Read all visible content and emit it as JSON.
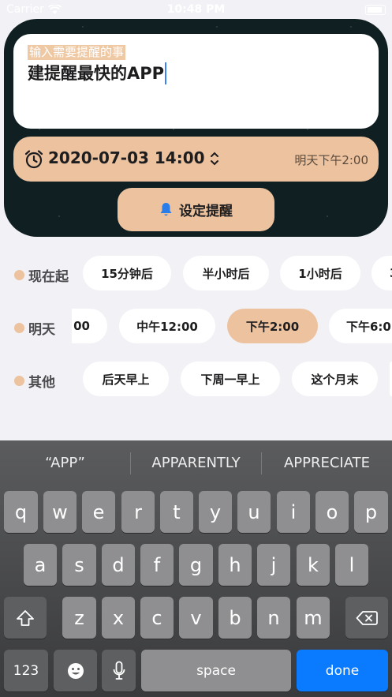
{
  "status_bar": {
    "carrier": "Carrier",
    "time": "10:48 PM"
  },
  "reminder_form": {
    "input_placeholder": "输入需要提醒的事",
    "input_value": "建提醒最快的APP",
    "datetime_value": "2020-07-03 14:00",
    "datetime_relative": "明天下午2:00",
    "set_button_label": "设定提醒"
  },
  "quick_rows": [
    {
      "label": "现在起",
      "chips": [
        "15分钟后",
        "半小时后",
        "1小时后",
        "3"
      ]
    },
    {
      "label": "明天",
      "chips": [
        "00",
        "中午12:00",
        "下午2:00",
        "下午6:0"
      ],
      "active_index": 2
    },
    {
      "label": "其他",
      "chips": [
        "后天早上",
        "下周一早上",
        "这个月末",
        ""
      ]
    }
  ],
  "keyboard": {
    "suggestions": [
      "“APP”",
      "APPARENTLY",
      "APPRECIATE"
    ],
    "row1": [
      "q",
      "w",
      "e",
      "r",
      "t",
      "y",
      "u",
      "i",
      "o",
      "p"
    ],
    "row2": [
      "a",
      "s",
      "d",
      "f",
      "g",
      "h",
      "j",
      "k",
      "l"
    ],
    "row3": [
      "z",
      "x",
      "c",
      "v",
      "b",
      "n",
      "m"
    ],
    "numbers_key": "123",
    "space_key": "space",
    "done_key": "done"
  },
  "colors": {
    "accent": "#ECC29F",
    "done_blue": "#0A7AFF",
    "page_bg": "#F2F1F6"
  }
}
